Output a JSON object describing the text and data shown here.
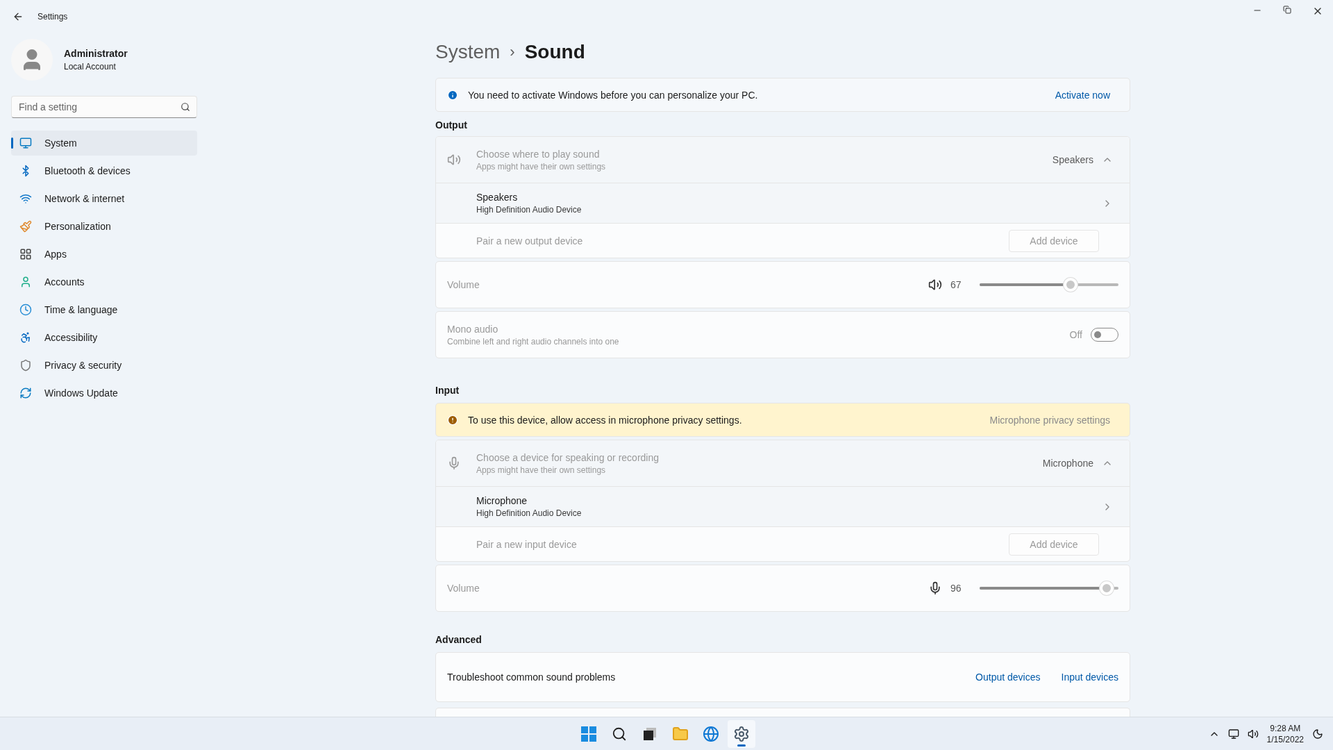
{
  "window": {
    "title": "Settings"
  },
  "user": {
    "name": "Administrator",
    "account": "Local Account"
  },
  "search": {
    "placeholder": "Find a setting"
  },
  "sidebar": {
    "items": [
      {
        "label": "System",
        "selected": true
      },
      {
        "label": "Bluetooth & devices",
        "selected": false
      },
      {
        "label": "Network & internet",
        "selected": false
      },
      {
        "label": "Personalization",
        "selected": false
      },
      {
        "label": "Apps",
        "selected": false
      },
      {
        "label": "Accounts",
        "selected": false
      },
      {
        "label": "Time & language",
        "selected": false
      },
      {
        "label": "Accessibility",
        "selected": false
      },
      {
        "label": "Privacy & security",
        "selected": false
      },
      {
        "label": "Windows Update",
        "selected": false
      }
    ]
  },
  "breadcrumb": {
    "parent": "System",
    "separator": "›",
    "current": "Sound"
  },
  "activation_banner": {
    "message": "You need to activate Windows before you can personalize your PC.",
    "link": "Activate now"
  },
  "output": {
    "heading": "Output",
    "picker": {
      "title": "Choose where to play sound",
      "subtitle": "Apps might have their own settings",
      "value": "Speakers",
      "expanded": true
    },
    "device": {
      "name": "Speakers",
      "description": "High Definition Audio Device"
    },
    "pair": {
      "label": "Pair a new output device",
      "button": "Add device"
    },
    "volume": {
      "label": "Volume",
      "reading": "67",
      "level": 0.67
    },
    "mono": {
      "title": "Mono audio",
      "subtitle": "Combine left and right audio channels into one",
      "state_label": "Off",
      "on": false
    }
  },
  "input": {
    "heading": "Input",
    "warning": {
      "message": "To use this device, allow access in microphone privacy settings.",
      "link": "Microphone privacy settings"
    },
    "picker": {
      "title": "Choose a device for speaking or recording",
      "subtitle": "Apps might have their own settings",
      "value": "Microphone",
      "expanded": true
    },
    "device": {
      "name": "Microphone",
      "description": "High Definition Audio Device"
    },
    "pair": {
      "label": "Pair a new input device",
      "button": "Add device"
    },
    "volume": {
      "label": "Volume",
      "reading": "96",
      "level": 0.96
    }
  },
  "advanced": {
    "heading": "Advanced",
    "troubleshoot": {
      "label": "Troubleshoot common sound problems",
      "links": [
        "Output devices",
        "Input devices"
      ]
    }
  },
  "taskbar": {
    "apps": [
      {
        "selected": false
      },
      {
        "selected": false
      },
      {
        "selected": false
      },
      {
        "selected": false
      },
      {
        "selected": false
      },
      {
        "selected": true
      }
    ],
    "time": "9:28 AM",
    "date": "1/15/2022"
  }
}
